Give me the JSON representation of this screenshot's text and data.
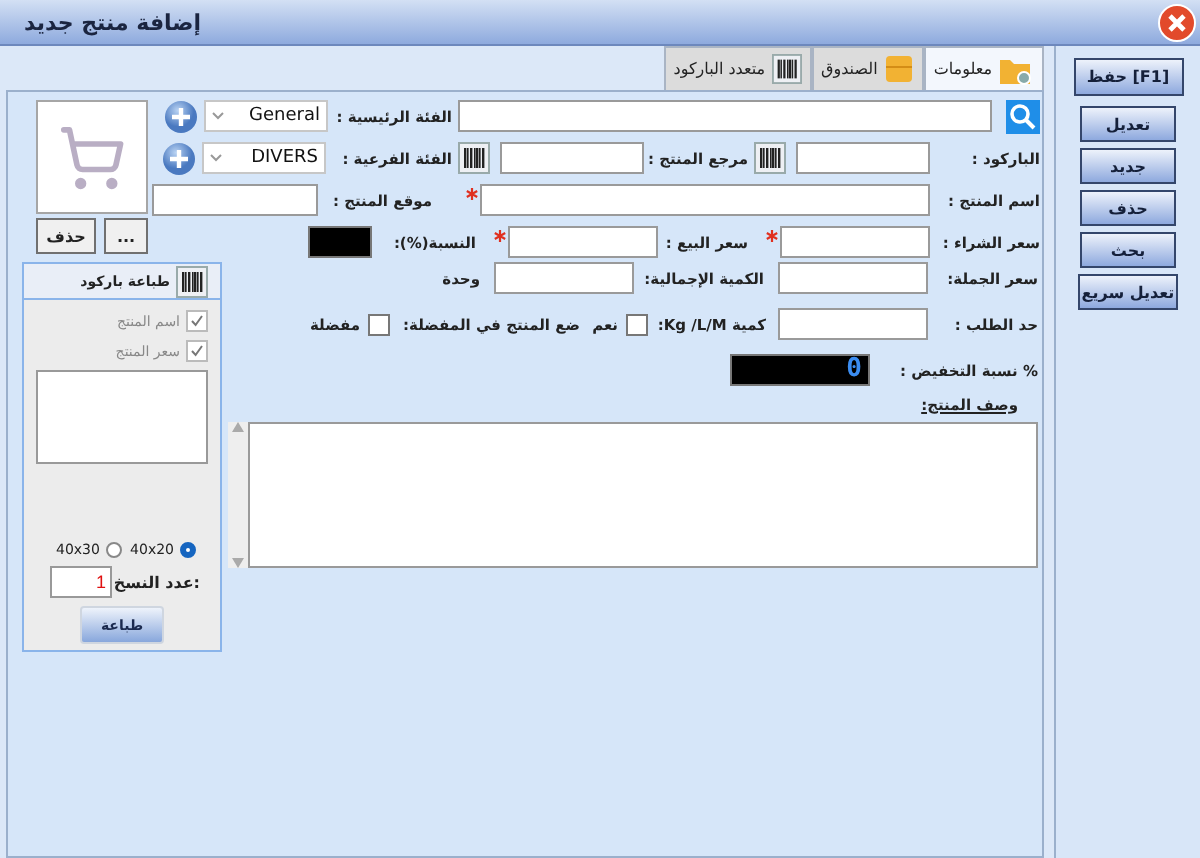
{
  "window": {
    "title": "إضافة منتج جديد"
  },
  "tabs": [
    {
      "label": "معلومات",
      "selected": true,
      "kind": "info"
    },
    {
      "label": "الصندوق",
      "selected": false,
      "kind": "box"
    },
    {
      "label": "متعدد الباركود",
      "selected": false,
      "kind": "barcode"
    }
  ],
  "image_buttons": [
    "...",
    "حذف"
  ],
  "main_category": {
    "label": "الفئة الرئيسية :",
    "value": "General"
  },
  "barcode": {
    "label": "الباركود :"
  },
  "reference": {
    "label": "مرجع المنتج :"
  },
  "sub_category": {
    "label": "الفئة الفرعية :",
    "value": "DIVERS"
  },
  "name": {
    "label": "اسم المنتج :",
    "required": true
  },
  "location": {
    "label": "موقع المنتج :"
  },
  "purchase_price": {
    "label": "سعر الشراء :",
    "required": true
  },
  "sale_price": {
    "label": "سعر البيع :",
    "required": true
  },
  "ratio": {
    "label": "النسبة(%):"
  },
  "wholesale_price": {
    "label": "سعر الجملة:"
  },
  "total_quantity": {
    "label": "الكمية الإجمالية:"
  },
  "unit": {
    "label": "وحدة"
  },
  "reorder_level": {
    "label": "حد الطلب :"
  },
  "weighted": {
    "label": "كمية Kg /L/M:",
    "option": "نعم",
    "checked": false
  },
  "favorite": {
    "label": "ضع المنتج في المفضلة:",
    "option": "مفضلة",
    "checked": false
  },
  "discount": {
    "label": "% نسبة التخفيض :",
    "value": "0"
  },
  "description": {
    "label": "وصف المنتج:"
  },
  "barcode_print": {
    "title": "طباعة باركود",
    "options": [
      {
        "label": "اسم المنتج",
        "checked": true,
        "disabled": true
      },
      {
        "label": "سعر المنتج",
        "checked": true,
        "disabled": true
      }
    ],
    "sizes": [
      {
        "label": "40x20",
        "selected": true
      },
      {
        "label": "40x30",
        "selected": false
      }
    ],
    "copies": {
      "label": "عدد النسخ:",
      "value": "1"
    },
    "button": "طباعة"
  },
  "actions": [
    "حفظ [F1]",
    "تعديل",
    "جديد",
    "حذف",
    "بحث",
    "تعديل سريع"
  ]
}
